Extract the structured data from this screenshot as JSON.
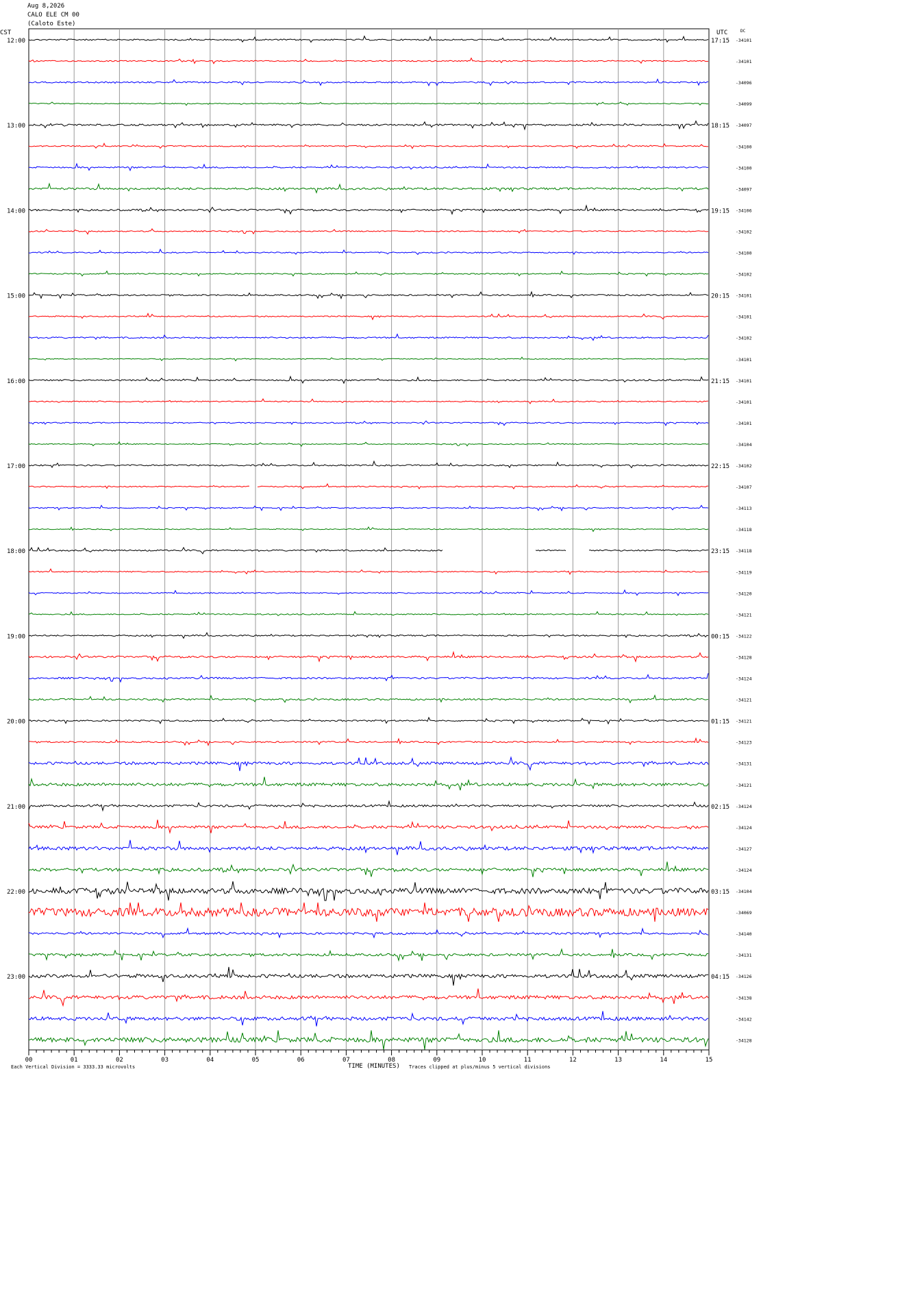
{
  "header": {
    "date": "Aug 8,2026",
    "station": "CALO ELE CM 00",
    "location": "(Caloto Este)"
  },
  "chart_data": {
    "type": "line",
    "title": "",
    "left_axis_label": "CST",
    "right_axis_label": "UTC",
    "dc_label": "DC",
    "xlabel": "TIME (MINUTES)",
    "xlim": [
      0,
      15
    ],
    "x_ticks": [
      "00",
      "01",
      "02",
      "03",
      "04",
      "05",
      "06",
      "07",
      "08",
      "09",
      "10",
      "11",
      "12",
      "13",
      "14",
      "15"
    ],
    "line_colors": [
      "#000000",
      "#ff0000",
      "#0000ff",
      "#008000"
    ],
    "left_hour_labels": [
      "12:00",
      "13:00",
      "14:00",
      "15:00",
      "16:00",
      "17:00",
      "18:00",
      "19:00",
      "20:00",
      "21:00",
      "22:00",
      "23:00"
    ],
    "right_hour_labels": [
      "17:15",
      "18:15",
      "19:15",
      "20:15",
      "21:15",
      "22:15",
      "23:15",
      "00:15",
      "01:15",
      "02:15",
      "03:15",
      "04:15"
    ],
    "dc_values": [
      "-34101",
      "-34101",
      "-34096",
      "-34099",
      "-34097",
      "-34100",
      "-34100",
      "-34097",
      "-34106",
      "-34102",
      "-34100",
      "-34102",
      "-34101",
      "-34101",
      "-34102",
      "-34101",
      "-34101",
      "-34101",
      "-34101",
      "-34104",
      "-34102",
      "-34107",
      "-34113",
      "-34118",
      "-34118",
      "-34119",
      "-34120",
      "-34121",
      "-34122",
      "-34128",
      "-34124",
      "-34121",
      "-34121",
      "-34123",
      "-34131",
      "-34121",
      "-34124",
      "-34124",
      "-34127",
      "-34124",
      "-34104",
      "-34069",
      "-34140",
      "-34131",
      "-34126",
      "-34138",
      "-34142",
      "-34128"
    ],
    "noise_amplitude": [
      1,
      0.8,
      1,
      0.6,
      1.2,
      0.8,
      1,
      1.5,
      1.2,
      0.8,
      0.8,
      0.8,
      1,
      0.8,
      1,
      0.6,
      1,
      0.8,
      0.8,
      0.6,
      1,
      0.8,
      0.8,
      0.6,
      1,
      0.8,
      0.8,
      0.8,
      1,
      1.3,
      1.2,
      1.2,
      1,
      1,
      2,
      2.2,
      1.5,
      2,
      2.5,
      2.2,
      4,
      6,
      1.5,
      1.8,
      2.5,
      2.5,
      2.5,
      3.5
    ],
    "gaps": [
      {
        "trace": 21,
        "from": 4.88,
        "to": 5.03
      },
      {
        "trace": 24,
        "from": 9.15,
        "to": 11.15
      },
      {
        "trace": 24,
        "from": 11.85,
        "to": 12.35
      }
    ],
    "footer_left": "Each Vertical Division = 3333.33 microvolts",
    "footer_right": "Traces clipped at plus/minus 5 vertical divisions"
  }
}
